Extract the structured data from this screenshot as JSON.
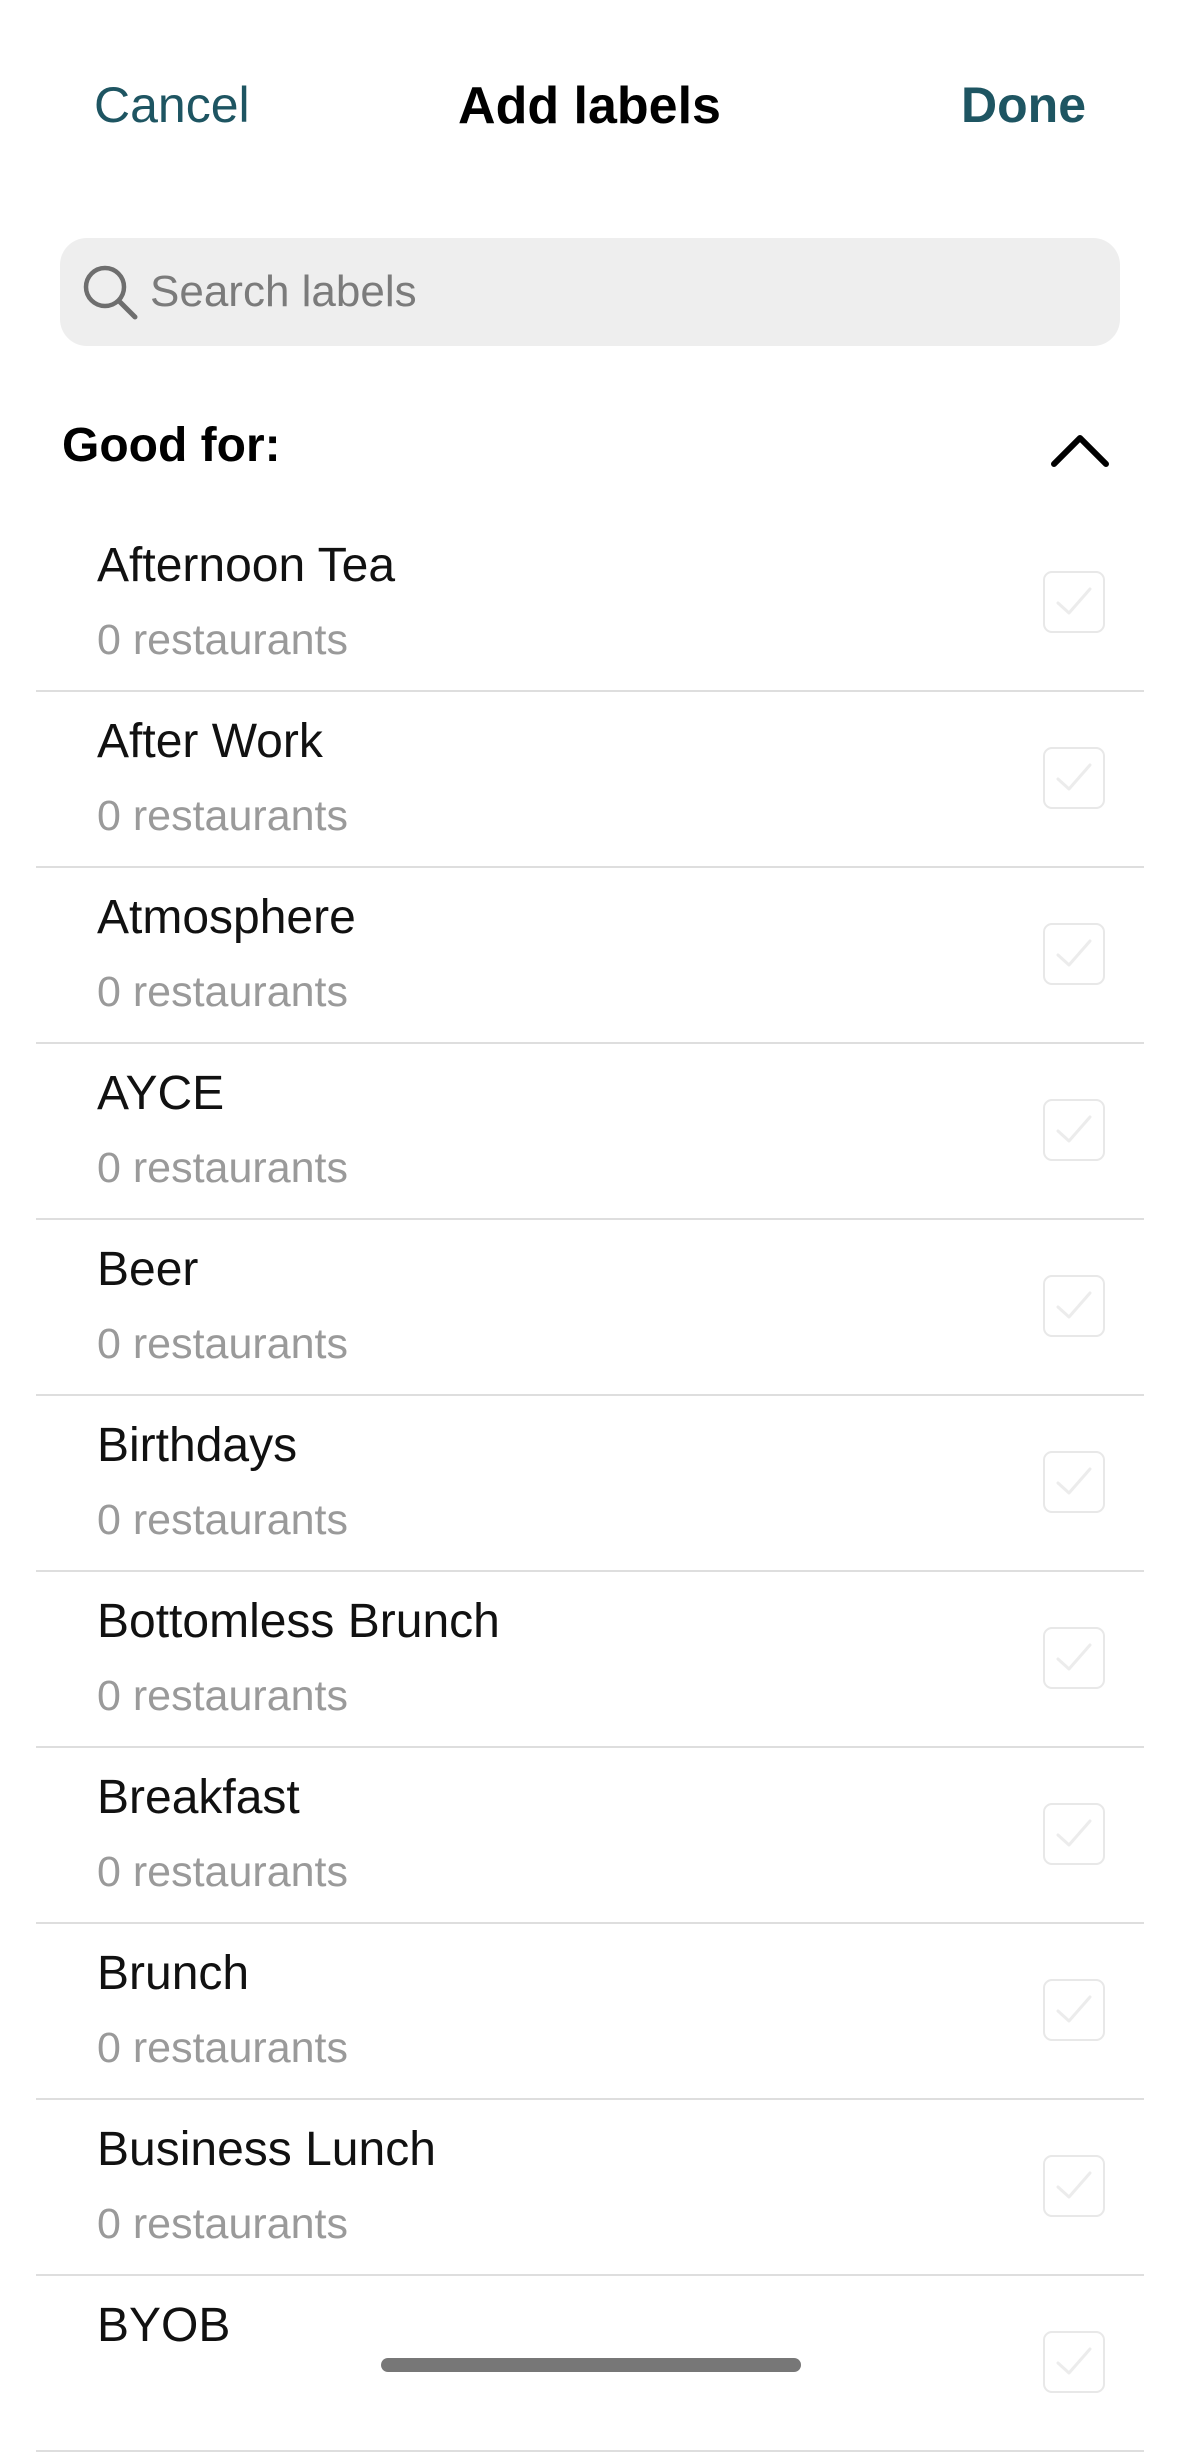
{
  "nav": {
    "cancel_label": "Cancel",
    "title": "Add labels",
    "done_label": "Done",
    "accent_color": "#1e5562"
  },
  "search": {
    "placeholder": "Search labels",
    "value": "",
    "icon": "search-icon"
  },
  "section": {
    "title": "Good for:",
    "toggle_icon": "chevron-up-icon",
    "expanded": true
  },
  "labels": [
    {
      "name": "Afternoon Tea",
      "count": "0 restaurants",
      "checked": false
    },
    {
      "name": "After Work",
      "count": "0 restaurants",
      "checked": false
    },
    {
      "name": "Atmosphere",
      "count": "0 restaurants",
      "checked": false
    },
    {
      "name": "AYCE",
      "count": "0 restaurants",
      "checked": false
    },
    {
      "name": "Beer",
      "count": "0 restaurants",
      "checked": false
    },
    {
      "name": "Birthdays",
      "count": "0 restaurants",
      "checked": false
    },
    {
      "name": "Bottomless Brunch",
      "count": "0 restaurants",
      "checked": false
    },
    {
      "name": "Breakfast",
      "count": "0 restaurants",
      "checked": false
    },
    {
      "name": "Brunch",
      "count": "0 restaurants",
      "checked": false
    },
    {
      "name": "Business Lunch",
      "count": "0 restaurants",
      "checked": false
    },
    {
      "name": "BYOB",
      "count": "",
      "checked": false
    }
  ]
}
